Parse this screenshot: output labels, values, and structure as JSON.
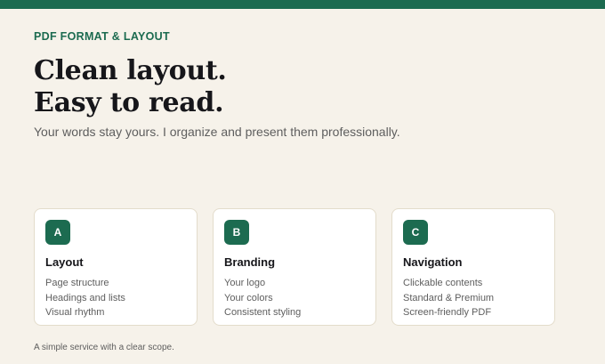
{
  "theme": {
    "accent": "#1c6b50",
    "background": "#f6f2ea",
    "card_background": "#ffffff",
    "card_border": "#e3dccb",
    "heading_color": "#16161a",
    "muted_text": "#5e5e5e"
  },
  "hero": {
    "eyebrow": "PDF FORMAT & LAYOUT",
    "headline_line1": "Clean layout.",
    "headline_line2": "Easy to read.",
    "subhead": "Your words stay yours. I organize and present them professionally."
  },
  "cards": [
    {
      "badge": "A",
      "title": "Layout",
      "items": [
        "Page structure",
        "Headings and lists",
        "Visual rhythm"
      ]
    },
    {
      "badge": "B",
      "title": "Branding",
      "items": [
        "Your logo",
        "Your colors",
        "Consistent styling"
      ]
    },
    {
      "badge": "C",
      "title": "Navigation",
      "items": [
        "Clickable contents",
        "Standard & Premium",
        "Screen-friendly PDF"
      ]
    }
  ],
  "footer": {
    "note": "A simple service with a clear scope."
  }
}
